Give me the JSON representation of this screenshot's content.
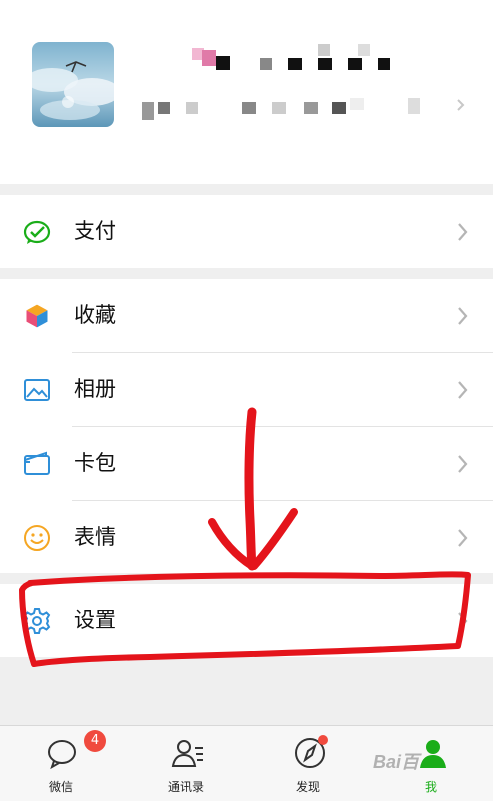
{
  "menu": {
    "pay_label": "支付",
    "favorites_label": "收藏",
    "album_label": "相册",
    "cards_label": "卡包",
    "stickers_label": "表情",
    "settings_label": "设置"
  },
  "tabbar": {
    "chats_label": "微信",
    "chats_badge": "4",
    "contacts_label": "通讯录",
    "discover_label": "发现",
    "me_label": "我"
  },
  "watermark": "Bai百",
  "colors": {
    "accent_green": "#1aad19",
    "badge_red": "#f04a3e",
    "annotation_red": "#e4141b"
  },
  "icons": {
    "pay": "wechat-pay-icon",
    "favorites": "cube-icon",
    "album": "image-icon",
    "cards": "wallet-icon",
    "stickers": "smiley-icon",
    "settings": "gear-icon"
  }
}
